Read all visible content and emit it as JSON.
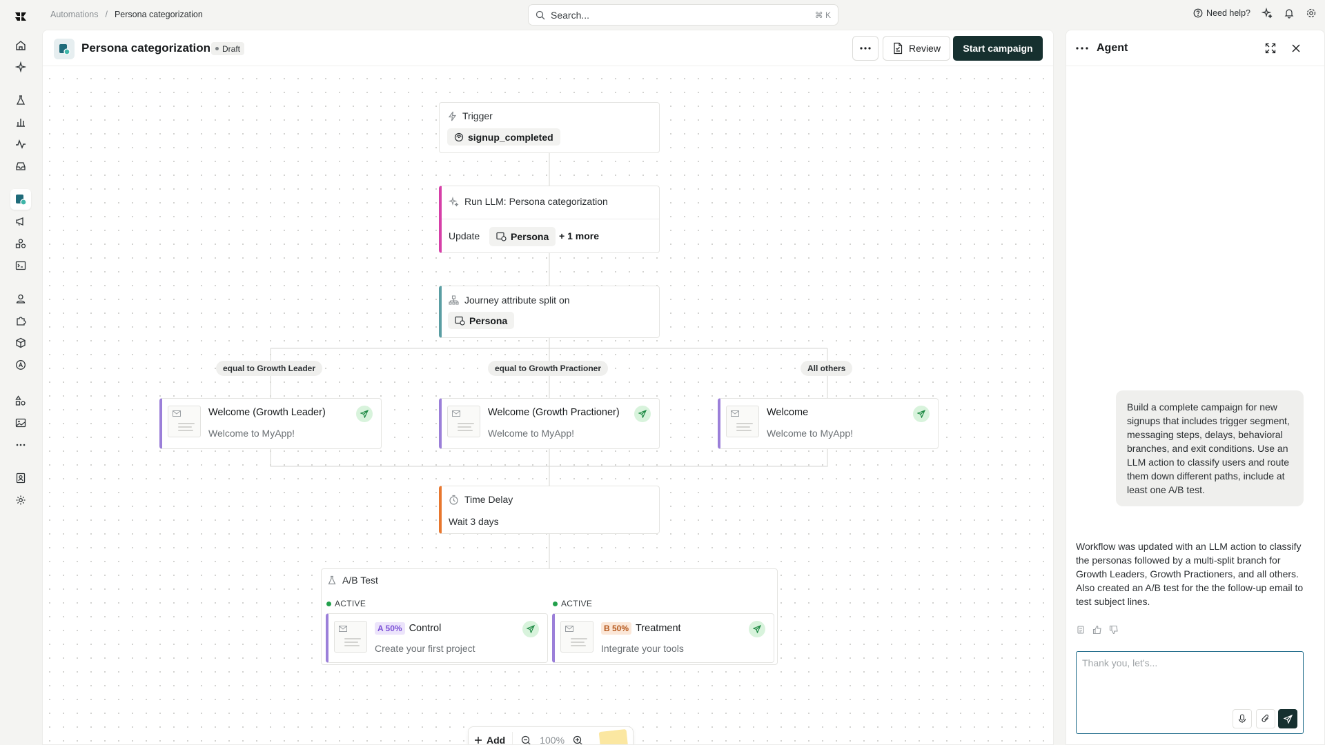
{
  "breadcrumb": {
    "parent": "Automations",
    "separator": "/",
    "current": "Persona categorization"
  },
  "search": {
    "placeholder": "Search...",
    "shortcut": "⌘ K"
  },
  "top_right": {
    "help_label": "Need help?"
  },
  "rail": {
    "icons": [
      "logo-icon",
      "home-icon",
      "sparkles-icon",
      "flask-icon",
      "bar-chart-icon",
      "activity-icon",
      "inbox-icon",
      "workflow-icon",
      "megaphone-icon",
      "shapes-icon",
      "terminal-icon",
      "user-icon",
      "puzzle-icon",
      "cube-icon",
      "badge-icon",
      "apps-icon",
      "image-icon",
      "more-icon",
      "contact-icon",
      "settings-icon"
    ]
  },
  "workflow": {
    "title": "Persona categorization",
    "status": "Draft",
    "review_label": "Review",
    "start_label": "Start campaign"
  },
  "nodes": {
    "trigger": {
      "label": "Trigger",
      "event": "signup_completed"
    },
    "llm": {
      "label": "Run LLM: Persona categorization",
      "update_label": "Update",
      "attribute": "Persona",
      "more": "+ 1 more",
      "accent": "#d63fa8"
    },
    "split": {
      "label": "Journey attribute split on",
      "attribute": "Persona",
      "accent": "#5a9ea3"
    },
    "branches": [
      {
        "condition": "equal to Growth Leader",
        "title": "Welcome (Growth Leader)",
        "subject": "Welcome to MyApp!"
      },
      {
        "condition": "equal to Growth Practioner",
        "title": "Welcome (Growth Practioner)",
        "subject": "Welcome to MyApp!"
      },
      {
        "condition": "All others",
        "title": "Welcome",
        "subject": "Welcome to MyApp!"
      }
    ],
    "delay": {
      "label": "Time Delay",
      "value": "Wait 3 days",
      "accent": "#e8772e"
    },
    "ab_test": {
      "label": "A/B Test",
      "variants": [
        {
          "status": "ACTIVE",
          "tag": "A 50%",
          "name": "Control",
          "subject": "Create your first project",
          "tag_color": "#7a4fd6",
          "tag_bg": "#ece4fb"
        },
        {
          "status": "ACTIVE",
          "tag": "B 50%",
          "name": "Treatment",
          "subject": "Integrate your tools",
          "tag_color": "#b5561a",
          "tag_bg": "#fbe7d8"
        }
      ]
    },
    "message_accent": "#9b7fd9"
  },
  "toolbar": {
    "add_label": "Add",
    "zoom": "100%"
  },
  "agent": {
    "title": "Agent",
    "user_message": "Build a complete campaign for new signups that includes trigger segment, messaging steps, delays, behavioral branches, and exit conditions. Use an LLM action to classify users and route them down different paths, include at least one A/B test.",
    "reply": "Workflow was updated with an LLM action to classify the personas followed by a multi-split branch for Growth Leaders, Growth Practioners, and all others. Also created an A/B test for the the follow-up email to test subject lines.",
    "composer_placeholder": "Thank you, let's..."
  }
}
